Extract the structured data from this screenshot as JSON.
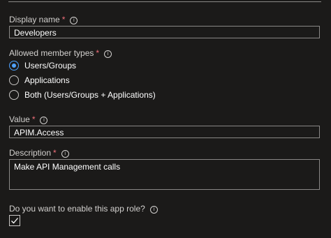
{
  "display_name": {
    "label": "Display name",
    "required_mark": "*",
    "value": "Developers"
  },
  "member_types": {
    "label": "Allowed member types",
    "required_mark": "*",
    "options": [
      {
        "label": "Users/Groups",
        "selected": true
      },
      {
        "label": "Applications",
        "selected": false
      },
      {
        "label": "Both (Users/Groups + Applications)",
        "selected": false
      }
    ]
  },
  "value_field": {
    "label": "Value",
    "required_mark": "*",
    "value": "APIM.Access"
  },
  "description": {
    "label": "Description",
    "required_mark": "*",
    "value": "Make API Management calls"
  },
  "enable_role": {
    "label": "Do you want to enable this app role?",
    "checked": true
  },
  "info_glyph": "i",
  "colors": {
    "background": "#1b1a19",
    "accent": "#4fa3ff",
    "required": "#f1707b",
    "border": "#8a8886"
  }
}
